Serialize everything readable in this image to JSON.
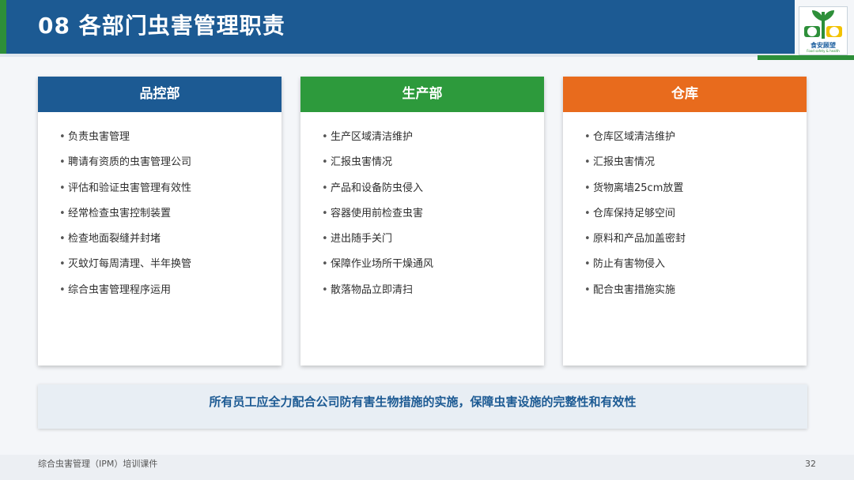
{
  "header": {
    "title": "08  各部门虫害管理职责"
  },
  "logo": {
    "name": "食安顾望",
    "tagline": "Food safety & health",
    "icon": "leaf-emblem-icon",
    "colors": [
      "#2d8f39",
      "#f2c200",
      "#1b5e9e"
    ]
  },
  "cards": [
    {
      "title": "品控部",
      "color": "#1c5a93",
      "items": [
        "负责虫害管理",
        "聘请有资质的虫害管理公司",
        "评估和验证虫害管理有效性",
        "经常检查虫害控制装置",
        "检查地面裂缝并封堵",
        "灭蚊灯每周清理、半年换管",
        "综合虫害管理程序运用"
      ]
    },
    {
      "title": "生产部",
      "color": "#2d9a3c",
      "items": [
        "生产区域清洁维护",
        "汇报虫害情况",
        "产品和设备防虫侵入",
        "容器使用前检查虫害",
        "进出随手关门",
        "保障作业场所干燥通风",
        "散落物品立即清扫"
      ]
    },
    {
      "title": "仓库",
      "color": "#e86b1d",
      "items": [
        "仓库区域清洁维护",
        "汇报虫害情况",
        "货物离墙25cm放置",
        "仓库保持足够空间",
        "原料和产品加盖密封",
        "防止有害物侵入",
        "配合虫害措施实施"
      ]
    }
  ],
  "bullet": "•",
  "banner": {
    "text": "所有员工应全力配合公司防有害生物措施的实施，保障虫害设施的完整性和有效性"
  },
  "footer": {
    "text": "综合虫害管理（IPM）培训课件",
    "page": "32"
  }
}
